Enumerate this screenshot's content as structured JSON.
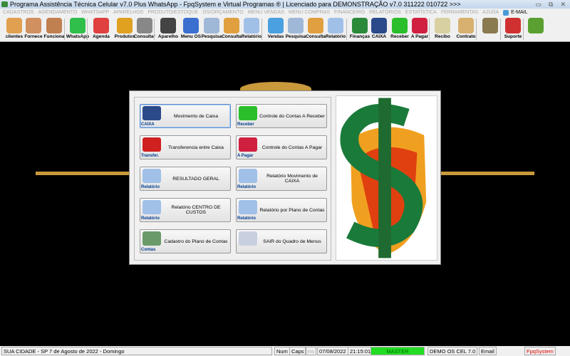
{
  "window": {
    "title": "Programa Assistência Técnica Celular v7.0 Plus WhatsApp - FpqSystem e Virtual Programas ® | Licenciado para  DEMONSTRAÇÃO v7.0 311222 010722 >>>",
    "controls": [
      "▭",
      "⧉",
      "✕"
    ]
  },
  "menu": [
    "CADASTROS",
    "AGENDAMENTO",
    "WHATSAPP",
    "APARELHOS",
    "PRODUTO/ESTOQUE",
    "OS/ORÇAMENTO",
    "MENU VENDAS",
    "MENU COMPRAS",
    "FINANCEIRO",
    "RELATÓRIOS",
    "ESTATÍSTICA",
    "FERRAMENTAS",
    "AJUDA"
  ],
  "menu_email": "E-MAIL",
  "toolbar": [
    {
      "label": "clientes",
      "color": "#e0a050"
    },
    {
      "label": "Fornece",
      "color": "#d09060"
    },
    {
      "label": "Funciona",
      "color": "#c08050"
    },
    {
      "label": "WhatsApp",
      "color": "#2fbf4a"
    },
    {
      "label": "Agenda",
      "color": "#e04040"
    },
    {
      "label": "Produtos",
      "color": "#e0a020"
    },
    {
      "label": "Consultar",
      "color": "#888888"
    },
    {
      "label": "Aparelho",
      "color": "#444444"
    },
    {
      "label": "Menu OS",
      "color": "#3a6fd0"
    },
    {
      "label": "Pesquisa",
      "color": "#9fb8d8"
    },
    {
      "label": "Consulta",
      "color": "#e0a040"
    },
    {
      "label": "Relatório",
      "color": "#a0c0e8"
    },
    {
      "label": "Vendas",
      "color": "#4aa0e0"
    },
    {
      "label": "Pesquisa",
      "color": "#9fb8d8"
    },
    {
      "label": "Consulta",
      "color": "#e0a040"
    },
    {
      "label": "Relatório",
      "color": "#a0c0e8"
    },
    {
      "label": "Finanças",
      "color": "#2a8a3a"
    },
    {
      "label": "CAIXA",
      "color": "#2a4a8a"
    },
    {
      "label": "Receber",
      "color": "#2abf2a"
    },
    {
      "label": "A Pagar",
      "color": "#d02040"
    },
    {
      "label": "Recibo",
      "color": "#d8d0a0"
    },
    {
      "label": "Contrato",
      "color": "#d8b070"
    },
    {
      "label": "",
      "color": "#8a7a50"
    },
    {
      "label": "Suporte",
      "color": "#d03030"
    },
    {
      "label": "",
      "color": "#5aa030"
    }
  ],
  "dialog": {
    "buttons": [
      {
        "label": "Movimento de Caixa",
        "icon_label": "CAIXA",
        "color": "#2a4a8a",
        "selected": true
      },
      {
        "label": "Controle do Contas A Receber",
        "icon_label": "Receber",
        "color": "#2abf2a"
      },
      {
        "label": "Transferencia entre Caixa",
        "icon_label": "Transfer.",
        "color": "#d02020"
      },
      {
        "label": "Controle do Contas A Pagar",
        "icon_label": "A Pagar",
        "color": "#d02040"
      },
      {
        "label": "RESULTADO GERAL",
        "icon_label": "Relatório",
        "color": "#a0c0e8"
      },
      {
        "label": "Relatório Movimento de CAIXA",
        "icon_label": "Relatório",
        "color": "#a0c0e8"
      },
      {
        "label": "Relatório CENTRO DE CUSTOS",
        "icon_label": "Relatório",
        "color": "#a0c0e8"
      },
      {
        "label": "Relatório por Plano de Contas",
        "icon_label": "Relatório",
        "color": "#a0c0e8"
      },
      {
        "label": "Cadastro do Plano de Contas",
        "icon_label": "Contas",
        "color": "#6a9a6a"
      },
      {
        "label": "SAIR do Quadro de Menus",
        "icon_label": "",
        "color": "#c8d0e0"
      }
    ]
  },
  "status": {
    "location": "SUA CIDADE - SP  7 de Agosto de 2022 - Domingo",
    "num": "Num",
    "caps": "Caps",
    "ins": "Ins",
    "date": "07/08/2022",
    "time": "21:15:01",
    "user": "MASTER",
    "user_color": "#22dd22",
    "version": "DEMO OS CEL 7.0",
    "email": "Email",
    "brand": "FpqSystem"
  }
}
